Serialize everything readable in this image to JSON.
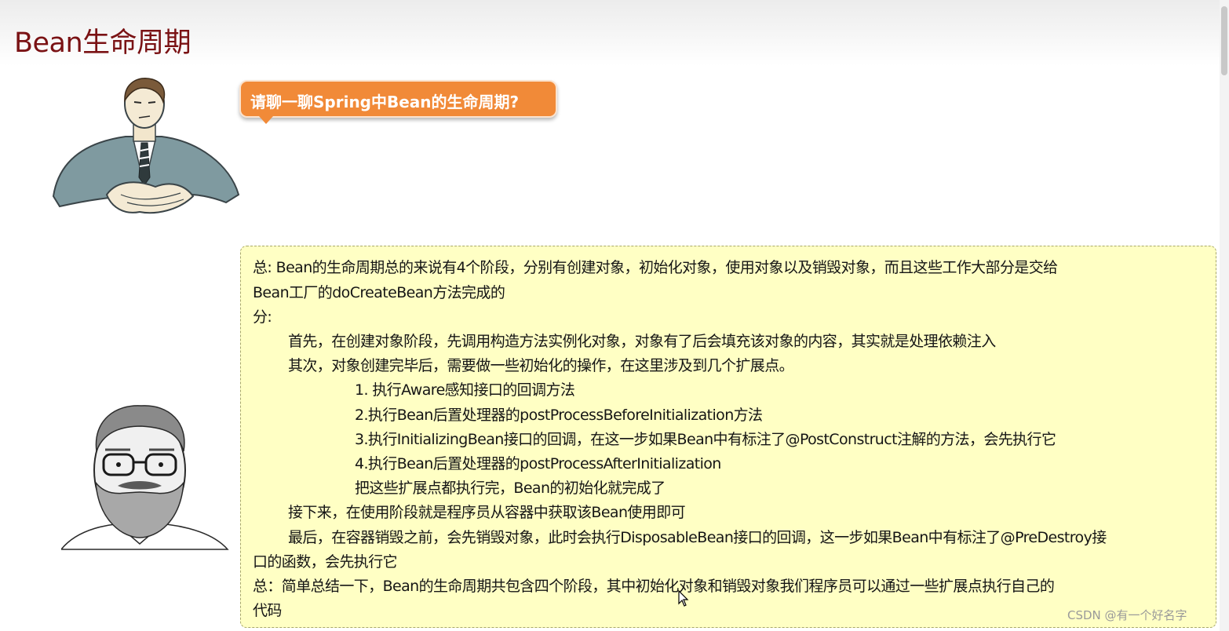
{
  "slide": {
    "title": "Bean生命周期"
  },
  "question": {
    "text": "请聊一聊Spring中Bean的生命周期?"
  },
  "answer": {
    "lines": [
      "总: Bean的生命周期总的来说有4个阶段，分别有创建对象，初始化对象，使用对象以及销毁对象，而且这些工作大部分是交给",
      "Bean工厂的doCreateBean方法完成的",
      "分:",
      "首先，在创建对象阶段，先调用构造方法实例化对象，对象有了后会填充该对象的内容，其实就是处理依赖注入",
      "其次，对象创建完毕后，需要做一些初始化的操作，在这里涉及到几个扩展点。",
      "1. 执行Aware感知接口的回调方法",
      "2.执行Bean后置处理器的postProcessBeforeInitialization方法",
      "3.执行InitializingBean接口的回调，在这一步如果Bean中有标注了@PostConstruct注解的方法，会先执行它",
      "4.执行Bean后置处理器的postProcessAfterInitialization",
      "把这些扩展点都执行完，Bean的初始化就完成了",
      "接下来，在使用阶段就是程序员从容器中获取该Bean使用即可",
      "最后，在容器销毁之前，会先销毁对象，此时会执行DisposableBean接口的回调，这一步如果Bean中有标注了@PreDestroy接",
      "口的函数，会先执行它",
      "总：简单总结一下，Bean的生命周期共包含四个阶段，其中初始化对象和销毁对象我们程序员可以通过一些扩展点执行自己的",
      "代码"
    ]
  },
  "watermark": {
    "text": "CSDN @有一个好名字"
  },
  "icons": {
    "interviewer": "interviewer-illustration",
    "engineer": "bearded-engineer-illustration",
    "cursor": "mouse-cursor-icon"
  },
  "colors": {
    "title": "#7a1214",
    "bubble": "#f18a38",
    "answer_background": "#ffffc4"
  }
}
